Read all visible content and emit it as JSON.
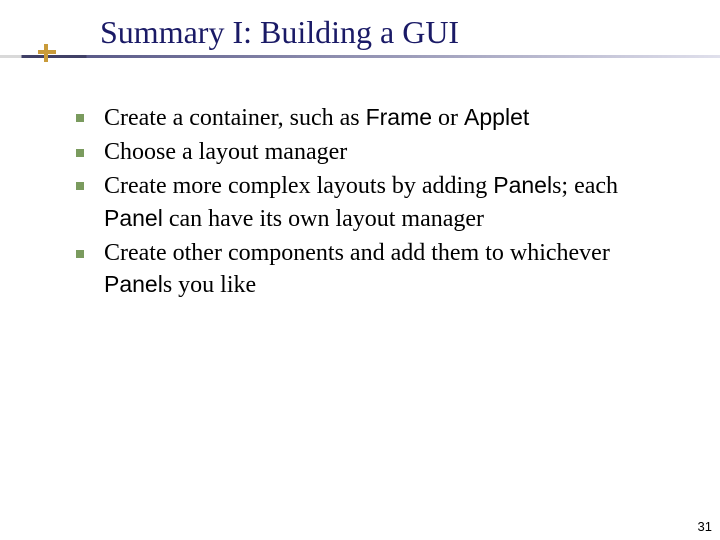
{
  "title": "Summary I: Building a GUI",
  "bullets": [
    {
      "parts": [
        {
          "t": "Create a container, such as  ",
          "c": false
        },
        {
          "t": "Frame",
          "c": true
        },
        {
          "t": " or  ",
          "c": false
        },
        {
          "t": "Applet",
          "c": true
        }
      ]
    },
    {
      "parts": [
        {
          "t": "Choose a layout manager",
          "c": false
        }
      ]
    },
    {
      "parts": [
        {
          "t": "Create more complex layouts by adding ",
          "c": false
        },
        {
          "t": "Panel",
          "c": true
        },
        {
          "t": "s; each ",
          "c": false
        },
        {
          "t": "Panel",
          "c": true
        },
        {
          "t": " can have its own layout manager",
          "c": false
        }
      ]
    },
    {
      "parts": [
        {
          "t": "Create other components and add them to whichever ",
          "c": false
        },
        {
          "t": "Panel",
          "c": true
        },
        {
          "t": "s you like",
          "c": false
        }
      ]
    }
  ],
  "page_number": "31"
}
